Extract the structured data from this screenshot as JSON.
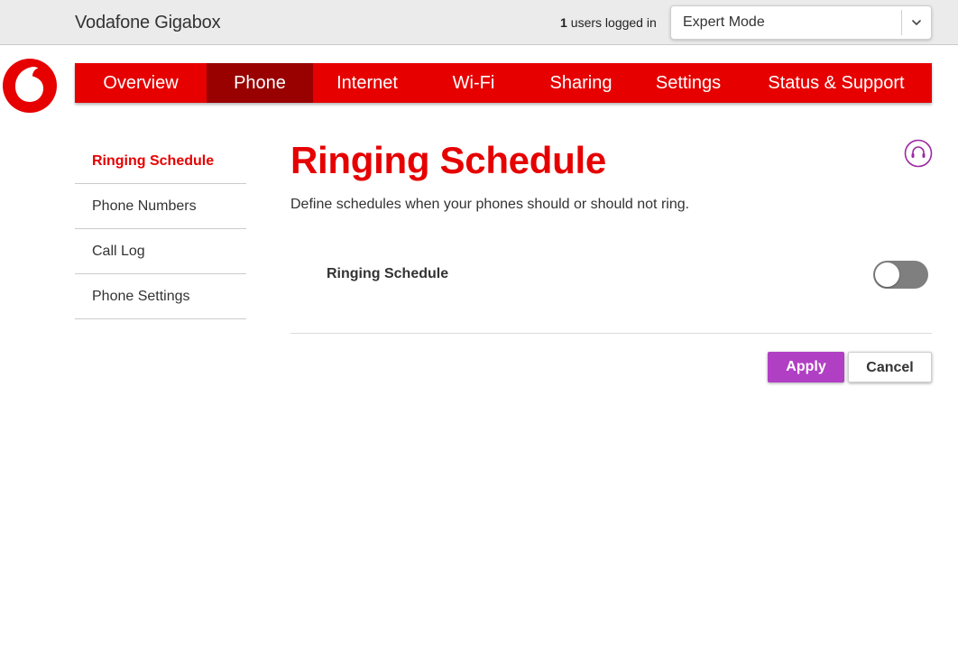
{
  "header": {
    "app_title": "Vodafone Gigabox",
    "users_count": "1",
    "users_text": "users logged in",
    "mode_select": {
      "value": "Expert Mode",
      "icon": "chevron-down-icon"
    }
  },
  "logo": {
    "icon": "vodafone-logo-icon",
    "color": "#e60000"
  },
  "nav": {
    "items": [
      {
        "label": "Overview"
      },
      {
        "label": "Phone",
        "active": true
      },
      {
        "label": "Internet"
      },
      {
        "label": "Wi-Fi"
      },
      {
        "label": "Sharing"
      },
      {
        "label": "Settings"
      },
      {
        "label": "Status & Support"
      }
    ]
  },
  "sidebar": {
    "items": [
      {
        "label": "Ringing Schedule",
        "active": true
      },
      {
        "label": "Phone Numbers"
      },
      {
        "label": "Call Log"
      },
      {
        "label": "Phone Settings"
      }
    ]
  },
  "main": {
    "title": "Ringing Schedule",
    "description": "Define schedules when your phones should or should not ring.",
    "help_icon": "help-headset-icon",
    "setting": {
      "label": "Ringing Schedule",
      "enabled": false
    },
    "apply_label": "Apply",
    "cancel_label": "Cancel"
  },
  "colors": {
    "brand_red": "#e60000",
    "active_nav": "#990000",
    "apply_purple": "#b13fc4",
    "toggle_off": "#7f7f7f"
  }
}
